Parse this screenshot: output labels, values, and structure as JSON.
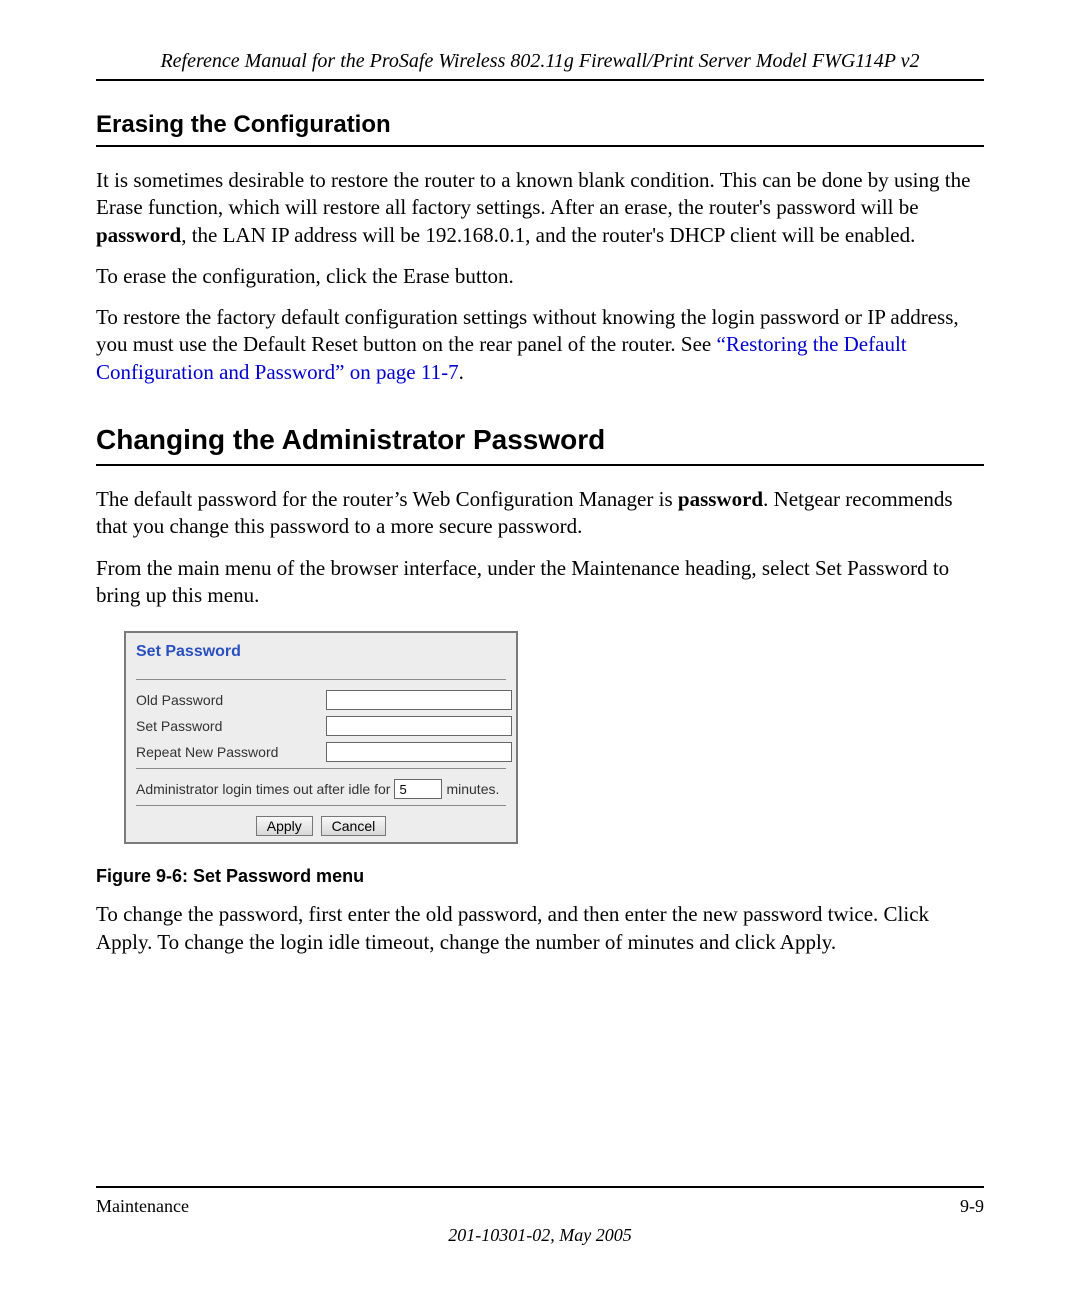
{
  "header": {
    "running": "Reference Manual for the ProSafe Wireless 802.11g  Firewall/Print Server Model FWG114P v2"
  },
  "section1": {
    "title": "Erasing the Configuration",
    "p1a": "It is sometimes desirable to restore the router to a known blank condition. This can be done by using the Erase function, which will restore all factory settings. After an erase, the router's password will be ",
    "p1_bold": "password",
    "p1b": ", the LAN IP address will be 192.168.0.1, and the router's DHCP client will be enabled.",
    "p2": "To erase the configuration, click the Erase button.",
    "p3a": "To restore the factory default configuration settings without knowing the login password or IP address, you must use the Default Reset button on the rear panel of the router. See ",
    "p3_link": "“Restoring the Default Configuration and Password” on page 11-7",
    "p3b": "."
  },
  "section2": {
    "title": "Changing the Administrator Password",
    "p1a": "The default password for the router’s Web Configuration Manager is ",
    "p1_bold": "password",
    "p1b": ". Netgear recommends that you change this password to a more secure password.",
    "p2": "From the main menu of the browser interface, under the Maintenance heading, select Set Password to bring up this menu."
  },
  "panel": {
    "title": "Set Password",
    "old_label": "Old Password",
    "set_label": "Set Password",
    "repeat_label": "Repeat New Password",
    "old_value": "",
    "set_value": "",
    "repeat_value": "",
    "timeout_pre": "Administrator login times out after idle for",
    "timeout_value": "5",
    "timeout_post": "minutes.",
    "apply": "Apply",
    "cancel": "Cancel"
  },
  "figure": {
    "caption": "Figure 9-6:  Set Password menu"
  },
  "after": {
    "p": "To change the password, first enter the old password, and then enter the new password twice. Click Apply. To change the login idle timeout, change the number of minutes and click Apply."
  },
  "footer": {
    "left": "Maintenance",
    "right": "9-9",
    "docid": "201-10301-02, May 2005"
  }
}
